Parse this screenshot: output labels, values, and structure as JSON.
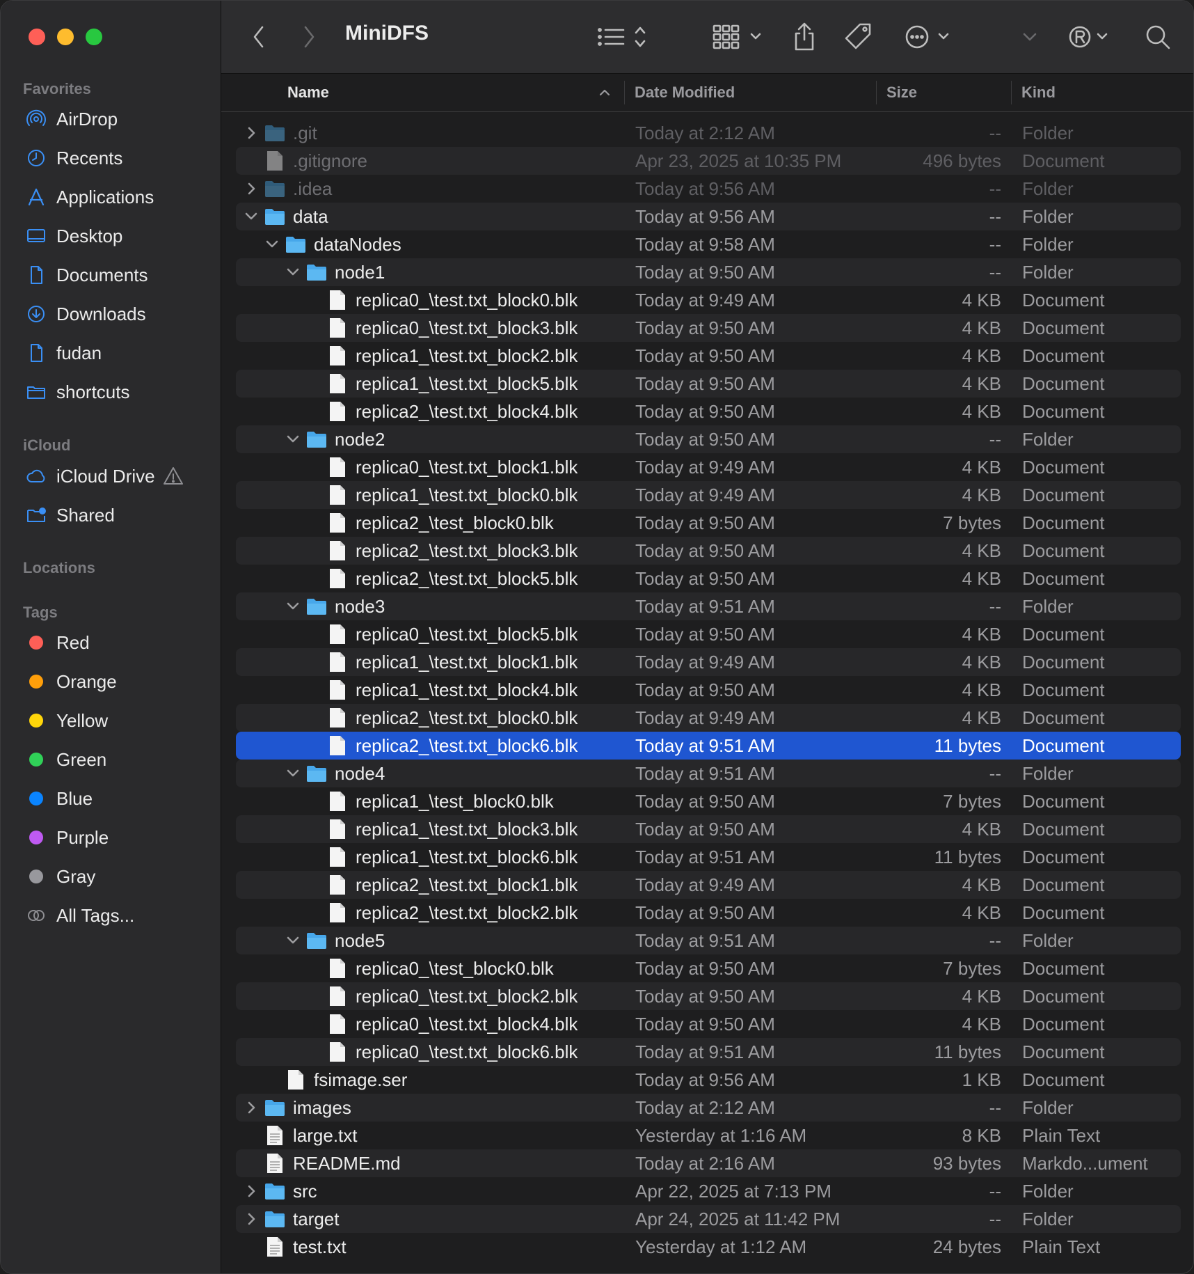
{
  "window": {
    "title": "MiniDFS"
  },
  "colors": {
    "selection": "#1f56d1",
    "folder": "#47a7ea",
    "accent": "#3a8ff5"
  },
  "sidebar": {
    "favorites_label": "Favorites",
    "favorites": [
      {
        "label": "AirDrop",
        "icon": "airdrop-icon"
      },
      {
        "label": "Recents",
        "icon": "clock-icon"
      },
      {
        "label": "Applications",
        "icon": "applications-icon"
      },
      {
        "label": "Desktop",
        "icon": "desktop-icon"
      },
      {
        "label": "Documents",
        "icon": "document-icon"
      },
      {
        "label": "Downloads",
        "icon": "download-icon"
      },
      {
        "label": "fudan",
        "icon": "document-icon"
      },
      {
        "label": "shortcuts",
        "icon": "folder-icon"
      }
    ],
    "icloud_label": "iCloud",
    "icloud": [
      {
        "label": "iCloud Drive",
        "icon": "cloud-icon"
      },
      {
        "label": "Shared",
        "icon": "shared-folder-icon"
      }
    ],
    "locations_label": "Locations",
    "tags_label": "Tags",
    "tags": [
      {
        "label": "Red",
        "color": "#fe5f57"
      },
      {
        "label": "Orange",
        "color": "#ff9f0a"
      },
      {
        "label": "Yellow",
        "color": "#ffd60a"
      },
      {
        "label": "Green",
        "color": "#30d158"
      },
      {
        "label": "Blue",
        "color": "#0a84ff"
      },
      {
        "label": "Purple",
        "color": "#bf5af2"
      },
      {
        "label": "Gray",
        "color": "#98989d"
      },
      {
        "label": "All Tags...",
        "color": ""
      }
    ]
  },
  "columns": {
    "name": "Name",
    "date": "Date Modified",
    "size": "Size",
    "kind": "Kind"
  },
  "rows": [
    {
      "name": ".git",
      "date": "Today at 2:12 AM",
      "size": "--",
      "kind": "Folder",
      "depth": 0,
      "type": "folder",
      "chev": "right",
      "dim": true
    },
    {
      "name": ".gitignore",
      "date": "Apr 23, 2025 at 10:35 PM",
      "size": "496 bytes",
      "kind": "Document",
      "depth": 0,
      "type": "file",
      "chev": "",
      "dim": true
    },
    {
      "name": ".idea",
      "date": "Today at 9:56 AM",
      "size": "--",
      "kind": "Folder",
      "depth": 0,
      "type": "folder",
      "chev": "right",
      "dim": true
    },
    {
      "name": "data",
      "date": "Today at 9:56 AM",
      "size": "--",
      "kind": "Folder",
      "depth": 0,
      "type": "folder",
      "chev": "down"
    },
    {
      "name": "dataNodes",
      "date": "Today at 9:58 AM",
      "size": "--",
      "kind": "Folder",
      "depth": 1,
      "type": "folder",
      "chev": "down"
    },
    {
      "name": "node1",
      "date": "Today at 9:50 AM",
      "size": "--",
      "kind": "Folder",
      "depth": 2,
      "type": "folder",
      "chev": "down"
    },
    {
      "name": "replica0_\\test.txt_block0.blk",
      "date": "Today at 9:49 AM",
      "size": "4 KB",
      "kind": "Document",
      "depth": 3,
      "type": "file",
      "chev": ""
    },
    {
      "name": "replica0_\\test.txt_block3.blk",
      "date": "Today at 9:50 AM",
      "size": "4 KB",
      "kind": "Document",
      "depth": 3,
      "type": "file",
      "chev": ""
    },
    {
      "name": "replica1_\\test.txt_block2.blk",
      "date": "Today at 9:50 AM",
      "size": "4 KB",
      "kind": "Document",
      "depth": 3,
      "type": "file",
      "chev": ""
    },
    {
      "name": "replica1_\\test.txt_block5.blk",
      "date": "Today at 9:50 AM",
      "size": "4 KB",
      "kind": "Document",
      "depth": 3,
      "type": "file",
      "chev": ""
    },
    {
      "name": "replica2_\\test.txt_block4.blk",
      "date": "Today at 9:50 AM",
      "size": "4 KB",
      "kind": "Document",
      "depth": 3,
      "type": "file",
      "chev": ""
    },
    {
      "name": "node2",
      "date": "Today at 9:50 AM",
      "size": "--",
      "kind": "Folder",
      "depth": 2,
      "type": "folder",
      "chev": "down"
    },
    {
      "name": "replica0_\\test.txt_block1.blk",
      "date": "Today at 9:49 AM",
      "size": "4 KB",
      "kind": "Document",
      "depth": 3,
      "type": "file",
      "chev": ""
    },
    {
      "name": "replica1_\\test.txt_block0.blk",
      "date": "Today at 9:49 AM",
      "size": "4 KB",
      "kind": "Document",
      "depth": 3,
      "type": "file",
      "chev": ""
    },
    {
      "name": "replica2_\\test_block0.blk",
      "date": "Today at 9:50 AM",
      "size": "7 bytes",
      "kind": "Document",
      "depth": 3,
      "type": "file",
      "chev": ""
    },
    {
      "name": "replica2_\\test.txt_block3.blk",
      "date": "Today at 9:50 AM",
      "size": "4 KB",
      "kind": "Document",
      "depth": 3,
      "type": "file",
      "chev": ""
    },
    {
      "name": "replica2_\\test.txt_block5.blk",
      "date": "Today at 9:50 AM",
      "size": "4 KB",
      "kind": "Document",
      "depth": 3,
      "type": "file",
      "chev": ""
    },
    {
      "name": "node3",
      "date": "Today at 9:51 AM",
      "size": "--",
      "kind": "Folder",
      "depth": 2,
      "type": "folder",
      "chev": "down"
    },
    {
      "name": "replica0_\\test.txt_block5.blk",
      "date": "Today at 9:50 AM",
      "size": "4 KB",
      "kind": "Document",
      "depth": 3,
      "type": "file",
      "chev": ""
    },
    {
      "name": "replica1_\\test.txt_block1.blk",
      "date": "Today at 9:49 AM",
      "size": "4 KB",
      "kind": "Document",
      "depth": 3,
      "type": "file",
      "chev": ""
    },
    {
      "name": "replica1_\\test.txt_block4.blk",
      "date": "Today at 9:50 AM",
      "size": "4 KB",
      "kind": "Document",
      "depth": 3,
      "type": "file",
      "chev": ""
    },
    {
      "name": "replica2_\\test.txt_block0.blk",
      "date": "Today at 9:49 AM",
      "size": "4 KB",
      "kind": "Document",
      "depth": 3,
      "type": "file",
      "chev": ""
    },
    {
      "name": "replica2_\\test.txt_block6.blk",
      "date": "Today at 9:51 AM",
      "size": "11 bytes",
      "kind": "Document",
      "depth": 3,
      "type": "file",
      "chev": "",
      "selected": true
    },
    {
      "name": "node4",
      "date": "Today at 9:51 AM",
      "size": "--",
      "kind": "Folder",
      "depth": 2,
      "type": "folder",
      "chev": "down"
    },
    {
      "name": "replica1_\\test_block0.blk",
      "date": "Today at 9:50 AM",
      "size": "7 bytes",
      "kind": "Document",
      "depth": 3,
      "type": "file",
      "chev": ""
    },
    {
      "name": "replica1_\\test.txt_block3.blk",
      "date": "Today at 9:50 AM",
      "size": "4 KB",
      "kind": "Document",
      "depth": 3,
      "type": "file",
      "chev": ""
    },
    {
      "name": "replica1_\\test.txt_block6.blk",
      "date": "Today at 9:51 AM",
      "size": "11 bytes",
      "kind": "Document",
      "depth": 3,
      "type": "file",
      "chev": ""
    },
    {
      "name": "replica2_\\test.txt_block1.blk",
      "date": "Today at 9:49 AM",
      "size": "4 KB",
      "kind": "Document",
      "depth": 3,
      "type": "file",
      "chev": ""
    },
    {
      "name": "replica2_\\test.txt_block2.blk",
      "date": "Today at 9:50 AM",
      "size": "4 KB",
      "kind": "Document",
      "depth": 3,
      "type": "file",
      "chev": ""
    },
    {
      "name": "node5",
      "date": "Today at 9:51 AM",
      "size": "--",
      "kind": "Folder",
      "depth": 2,
      "type": "folder",
      "chev": "down"
    },
    {
      "name": "replica0_\\test_block0.blk",
      "date": "Today at 9:50 AM",
      "size": "7 bytes",
      "kind": "Document",
      "depth": 3,
      "type": "file",
      "chev": ""
    },
    {
      "name": "replica0_\\test.txt_block2.blk",
      "date": "Today at 9:50 AM",
      "size": "4 KB",
      "kind": "Document",
      "depth": 3,
      "type": "file",
      "chev": ""
    },
    {
      "name": "replica0_\\test.txt_block4.blk",
      "date": "Today at 9:50 AM",
      "size": "4 KB",
      "kind": "Document",
      "depth": 3,
      "type": "file",
      "chev": ""
    },
    {
      "name": "replica0_\\test.txt_block6.blk",
      "date": "Today at 9:51 AM",
      "size": "11 bytes",
      "kind": "Document",
      "depth": 3,
      "type": "file",
      "chev": ""
    },
    {
      "name": "fsimage.ser",
      "date": "Today at 9:56 AM",
      "size": "1 KB",
      "kind": "Document",
      "depth": 1,
      "type": "file",
      "chev": ""
    },
    {
      "name": "images",
      "date": "Today at 2:12 AM",
      "size": "--",
      "kind": "Folder",
      "depth": 0,
      "type": "folder",
      "chev": "right"
    },
    {
      "name": "large.txt",
      "date": "Yesterday at 1:16 AM",
      "size": "8 KB",
      "kind": "Plain Text",
      "depth": 0,
      "type": "text",
      "chev": ""
    },
    {
      "name": "README.md",
      "date": "Today at 2:16 AM",
      "size": "93 bytes",
      "kind": "Markdo...ument",
      "depth": 0,
      "type": "text",
      "chev": ""
    },
    {
      "name": "src",
      "date": "Apr 22, 2025 at 7:13 PM",
      "size": "--",
      "kind": "Folder",
      "depth": 0,
      "type": "folder",
      "chev": "right"
    },
    {
      "name": "target",
      "date": "Apr 24, 2025 at 11:42 PM",
      "size": "--",
      "kind": "Folder",
      "depth": 0,
      "type": "folder",
      "chev": "right"
    },
    {
      "name": "test.txt",
      "date": "Yesterday at 1:12 AM",
      "size": "24 bytes",
      "kind": "Plain Text",
      "depth": 0,
      "type": "text",
      "chev": ""
    }
  ]
}
